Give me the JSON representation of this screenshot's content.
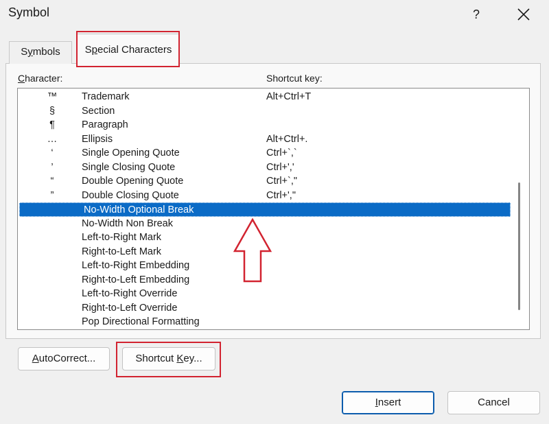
{
  "dialog": {
    "title": "Symbol",
    "help": "?"
  },
  "tabs": {
    "symbols": {
      "pre": "S",
      "u": "y",
      "post": "mbols"
    },
    "special": {
      "pre": "S",
      "u": "p",
      "post": "ecial Characters"
    }
  },
  "list": {
    "header_character": {
      "u": "C",
      "post": "haracter:"
    },
    "header_shortcut": "Shortcut key:",
    "rows": [
      {
        "symbol": "™",
        "name": "Trademark",
        "shortcut": "Alt+Ctrl+T"
      },
      {
        "symbol": "§",
        "name": "Section",
        "shortcut": ""
      },
      {
        "symbol": "¶",
        "name": "Paragraph",
        "shortcut": ""
      },
      {
        "symbol": "…",
        "name": "Ellipsis",
        "shortcut": "Alt+Ctrl+."
      },
      {
        "symbol": "‘",
        "name": "Single Opening Quote",
        "shortcut": "Ctrl+`,`"
      },
      {
        "symbol": "’",
        "name": "Single Closing Quote",
        "shortcut": "Ctrl+','"
      },
      {
        "symbol": "“",
        "name": "Double Opening Quote",
        "shortcut": "Ctrl+`,\""
      },
      {
        "symbol": "”",
        "name": "Double Closing Quote",
        "shortcut": "Ctrl+',\""
      },
      {
        "symbol": "",
        "name": "No-Width Optional Break",
        "shortcut": "",
        "selected": true
      },
      {
        "symbol": "",
        "name": "No-Width Non Break",
        "shortcut": ""
      },
      {
        "symbol": "",
        "name": "Left-to-Right Mark",
        "shortcut": ""
      },
      {
        "symbol": "",
        "name": "Right-to-Left Mark",
        "shortcut": ""
      },
      {
        "symbol": "",
        "name": "Left-to-Right Embedding",
        "shortcut": ""
      },
      {
        "symbol": "",
        "name": "Right-to-Left Embedding",
        "shortcut": ""
      },
      {
        "symbol": "",
        "name": "Left-to-Right Override",
        "shortcut": ""
      },
      {
        "symbol": "",
        "name": "Right-to-Left Override",
        "shortcut": ""
      },
      {
        "symbol": "",
        "name": "Pop Directional Formatting",
        "shortcut": ""
      }
    ]
  },
  "buttons": {
    "autocorrect": {
      "u": "A",
      "post": "utoCorrect..."
    },
    "shortcut": {
      "pre": "Shortcut ",
      "u": "K",
      "post": "ey..."
    },
    "insert": {
      "u": "I",
      "post": "nsert"
    },
    "cancel": "Cancel"
  },
  "colors": {
    "selection": "#0b6bc6",
    "highlight": "#d22330"
  }
}
